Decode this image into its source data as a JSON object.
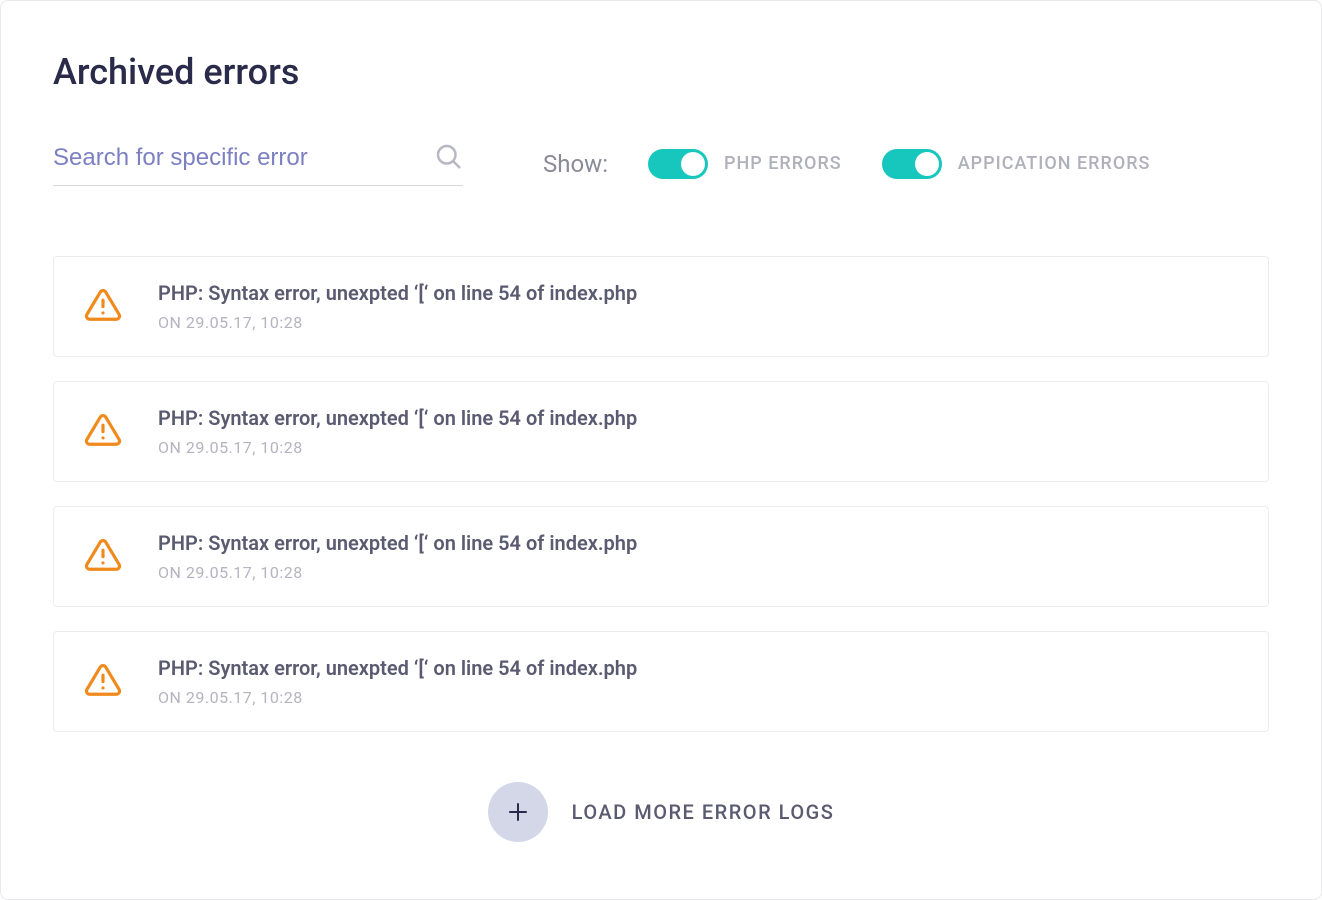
{
  "header": {
    "title": "Archived errors"
  },
  "search": {
    "placeholder": "Search for specific error"
  },
  "filters": {
    "show_label": "Show:",
    "php_errors_label": "PHP ERRORS",
    "application_errors_label": "APPICATION ERRORS"
  },
  "errors": [
    {
      "title": "PHP: Syntax error, unexpted ‘[‘ on line 54 of index.php",
      "timestamp": "ON 29.05.17, 10:28"
    },
    {
      "title": "PHP: Syntax error, unexpted ‘[‘ on line 54 of index.php",
      "timestamp": "ON 29.05.17, 10:28"
    },
    {
      "title": "PHP: Syntax error, unexpted ‘[‘ on line 54 of index.php",
      "timestamp": "ON 29.05.17, 10:28"
    },
    {
      "title": "PHP: Syntax error, unexpted ‘[‘ on line 54 of index.php",
      "timestamp": "ON 29.05.17, 10:28"
    }
  ],
  "load_more": {
    "label": "LOAD MORE ERROR LOGS"
  },
  "colors": {
    "accent": "#17c7be",
    "warning": "#f18a1c"
  }
}
